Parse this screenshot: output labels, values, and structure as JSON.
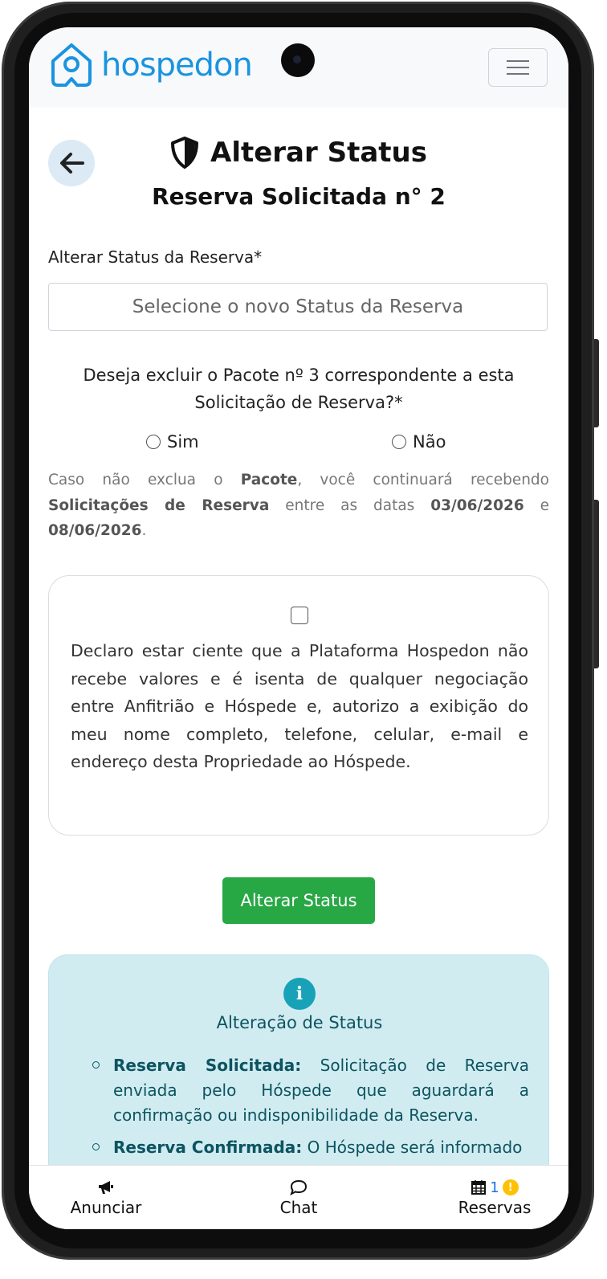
{
  "brand": {
    "name": "hospedon",
    "color": "#1a94e0"
  },
  "header": {
    "menu_icon": "hamburger-icon"
  },
  "page": {
    "back_icon": "arrow-left-icon",
    "title_icon": "shield-icon",
    "title": "Alterar Status",
    "subtitle": "Reserva Solicitada n° 2"
  },
  "form": {
    "status_label": "Alterar Status da Reserva*",
    "status_placeholder": "Selecione o novo Status da Reserva",
    "question": "Deseja excluir o Pacote nº 3 correspondente a esta Solicitação de Reserva?*",
    "option_yes": "Sim",
    "option_no": "Não",
    "note_p1": "Caso não exclua o ",
    "note_b1": "Pacote",
    "note_p2": ", você continuará recebendo ",
    "note_b2": "Solicitações de Reserva",
    "note_p3": " entre as datas ",
    "note_b3": "03/06/2026",
    "note_p4": " e ",
    "note_b4": "08/06/2026",
    "note_p5": ".",
    "consent_text": "Declaro estar ciente que a Plataforma Hospedon não recebe valores e é isenta de qualquer negociação entre Anfitrião e Hóspede e, autorizo a exibição do meu nome completo, telefone, celular, e-mail e endereço desta Propriedade ao Hóspede.",
    "submit_label": "Alterar Status",
    "submit_color": "#28a745"
  },
  "info": {
    "icon": "info-icon",
    "title": "Alteração de Status",
    "items": [
      {
        "term": "Reserva Solicitada:",
        "desc": " Solicitação de Reserva enviada pelo Hóspede que aguardará a confirmação ou indisponibilidade da Reserva."
      },
      {
        "term": "Reserva Confirmada:",
        "desc": " O Hóspede será informado"
      }
    ]
  },
  "bottom_nav": {
    "anunciar": {
      "label": "Anunciar",
      "icon": "megaphone-icon"
    },
    "chat": {
      "label": "Chat",
      "icon": "chat-bubble-icon"
    },
    "reservas": {
      "label": "Reservas",
      "icon": "calendar-icon",
      "count": "1",
      "alert": "!"
    }
  }
}
